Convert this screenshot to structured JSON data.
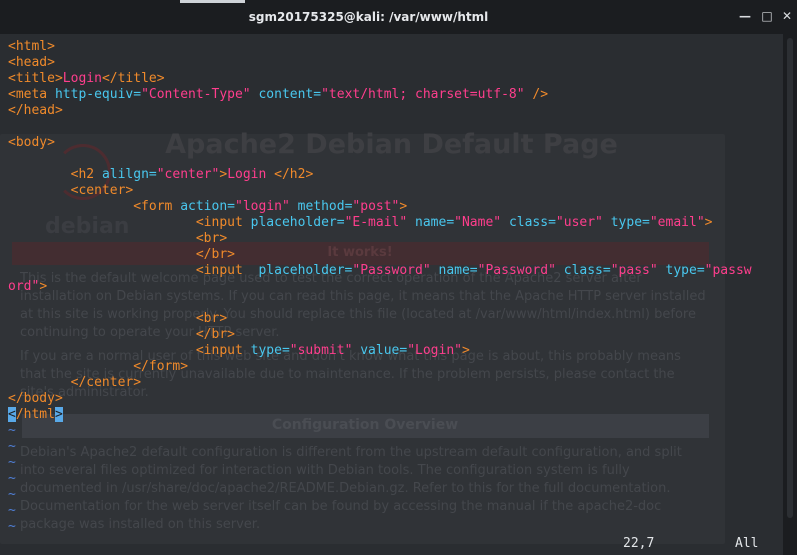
{
  "window": {
    "title": "sgm20175325@kali: /var/www/html",
    "buttons": {
      "minimize": "—",
      "maximize": "□",
      "close": "✕"
    }
  },
  "editor": {
    "lines": [
      [
        {
          "t": "<html>",
          "c": "tag"
        }
      ],
      [
        {
          "t": "<head>",
          "c": "tag"
        }
      ],
      [
        {
          "t": "<title>",
          "c": "tag"
        },
        {
          "t": "Login",
          "c": "str"
        },
        {
          "t": "</title>",
          "c": "tag"
        }
      ],
      [
        {
          "t": "<meta ",
          "c": "tag"
        },
        {
          "t": "http-equiv=",
          "c": "attr"
        },
        {
          "t": "\"Content-Type\"",
          "c": "str"
        },
        {
          "t": " content=",
          "c": "attr"
        },
        {
          "t": "\"text/html; charset=utf-8\"",
          "c": "str"
        },
        {
          "t": " />",
          "c": "tag"
        }
      ],
      [
        {
          "t": "</head>",
          "c": "tag"
        }
      ],
      [],
      [
        {
          "t": "<body>",
          "c": "tag"
        }
      ],
      [],
      [
        {
          "t": "        "
        },
        {
          "t": "<h2 ",
          "c": "tag"
        },
        {
          "t": "alilgn=",
          "c": "attr"
        },
        {
          "t": "\"center\"",
          "c": "str"
        },
        {
          "t": ">",
          "c": "tag"
        },
        {
          "t": "Login ",
          "c": "str"
        },
        {
          "t": "</h2>",
          "c": "tag"
        }
      ],
      [
        {
          "t": "        "
        },
        {
          "t": "<center>",
          "c": "tag"
        }
      ],
      [
        {
          "t": "                "
        },
        {
          "t": "<form ",
          "c": "tag"
        },
        {
          "t": "action=",
          "c": "attr"
        },
        {
          "t": "\"login\"",
          "c": "str"
        },
        {
          "t": " method=",
          "c": "attr"
        },
        {
          "t": "\"post\"",
          "c": "str"
        },
        {
          "t": ">",
          "c": "tag"
        }
      ],
      [
        {
          "t": "                        "
        },
        {
          "t": "<input ",
          "c": "tag"
        },
        {
          "t": "placeholder=",
          "c": "attr"
        },
        {
          "t": "\"E-mail\"",
          "c": "str"
        },
        {
          "t": " name=",
          "c": "attr"
        },
        {
          "t": "\"Name\"",
          "c": "str"
        },
        {
          "t": " class=",
          "c": "attr"
        },
        {
          "t": "\"user\"",
          "c": "str"
        },
        {
          "t": " type=",
          "c": "attr"
        },
        {
          "t": "\"email\"",
          "c": "str"
        },
        {
          "t": ">",
          "c": "tag"
        }
      ],
      [
        {
          "t": "                        "
        },
        {
          "t": "<br>",
          "c": "tag"
        }
      ],
      [
        {
          "t": "                        "
        },
        {
          "t": "</br>",
          "c": "tag"
        }
      ],
      [
        {
          "t": "                        "
        },
        {
          "t": "<input  ",
          "c": "tag"
        },
        {
          "t": "placeholder=",
          "c": "attr"
        },
        {
          "t": "\"Password\"",
          "c": "str"
        },
        {
          "t": " name=",
          "c": "attr"
        },
        {
          "t": "\"Password\"",
          "c": "str"
        },
        {
          "t": " class=",
          "c": "attr"
        },
        {
          "t": "\"pass\"",
          "c": "str"
        },
        {
          "t": " type=",
          "c": "attr"
        },
        {
          "t": "\"passw",
          "c": "str"
        }
      ],
      [
        {
          "t": "ord\"",
          "c": "str"
        },
        {
          "t": ">",
          "c": "tag"
        }
      ],
      [],
      [
        {
          "t": "                        "
        },
        {
          "t": "<br>",
          "c": "tag"
        }
      ],
      [
        {
          "t": "                        "
        },
        {
          "t": "</br>",
          "c": "tag"
        }
      ],
      [
        {
          "t": "                        "
        },
        {
          "t": "<input ",
          "c": "tag"
        },
        {
          "t": "type=",
          "c": "attr"
        },
        {
          "t": "\"submit\"",
          "c": "str"
        },
        {
          "t": " value=",
          "c": "attr"
        },
        {
          "t": "\"Login\"",
          "c": "str"
        },
        {
          "t": ">",
          "c": "tag"
        }
      ],
      [
        {
          "t": "                "
        },
        {
          "t": "</form>",
          "c": "tag"
        }
      ],
      [
        {
          "t": "        "
        },
        {
          "t": "</center>",
          "c": "tag"
        }
      ],
      [
        {
          "t": "</body>",
          "c": "tag"
        }
      ],
      [
        {
          "t": "<",
          "c": "cursor"
        },
        {
          "t": "/html",
          "c": "tag"
        },
        {
          "t": ">",
          "c": "cursor"
        }
      ],
      [
        {
          "t": "~",
          "c": "tilde"
        }
      ],
      [
        {
          "t": "~",
          "c": "tilde"
        }
      ],
      [
        {
          "t": "~",
          "c": "tilde"
        }
      ],
      [
        {
          "t": "~",
          "c": "tilde"
        }
      ],
      [
        {
          "t": "~",
          "c": "tilde"
        }
      ],
      [
        {
          "t": "~",
          "c": "tilde"
        }
      ],
      [
        {
          "t": "~",
          "c": "tilde"
        }
      ]
    ],
    "status": {
      "position": "22,7",
      "scroll": "All"
    }
  },
  "background_page": {
    "heading": "Apache2 Debian Default Page",
    "logo": "debian",
    "banner": "It works!",
    "section": "Configuration Overview",
    "paragraphs": [
      "This is the default welcome page used to test the correct operation of the Apache2 server after installation on Debian systems. If you can read this page, it means that the Apache HTTP server installed at this site is working properly. You should replace this file (located at /var/www/html/index.html) before continuing to operate your HTTP server.",
      "If you are a normal user of this web site and don't know what this page is about, this probably means that the site is currently unavailable due to maintenance. If the problem persists, please contact the site's administrator.",
      "Debian's Apache2 default configuration is different from the upstream default configuration, and split into several files optimized for interaction with Debian tools. The configuration system is fully documented in /usr/share/doc/apache2/README.Debian.gz. Refer to this for the full documentation. Documentation for the web server itself can be found by accessing the manual if the apache2-doc package was installed on this server."
    ]
  }
}
